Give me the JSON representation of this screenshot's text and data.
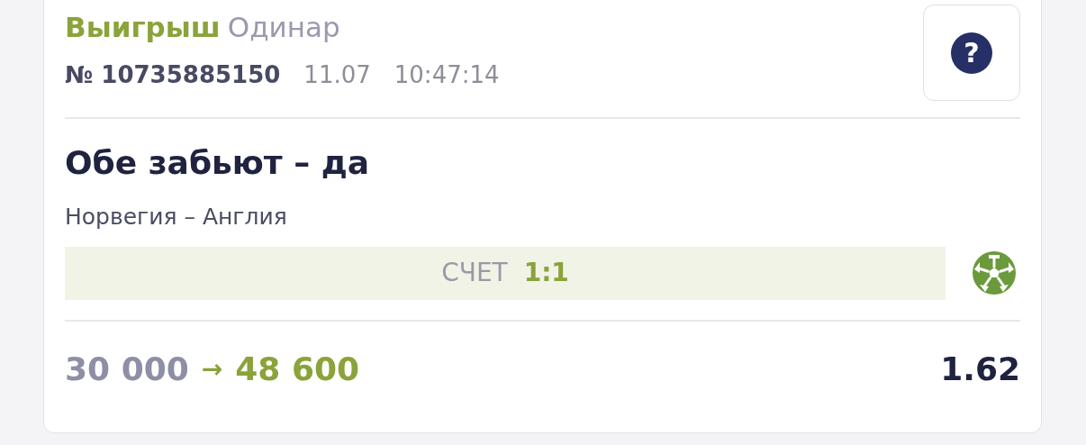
{
  "bet": {
    "result": "Выигрыш",
    "type": "Одинар",
    "number": "№ 10735885150",
    "date": "11.07",
    "time": "10:47:14"
  },
  "help_button": {
    "label": "?"
  },
  "selection": {
    "title": "Обе забьют – да",
    "match": "Норвегия – Англия"
  },
  "score": {
    "label": "СЧЕТ",
    "value": "1:1"
  },
  "totals": {
    "stake": "30 000",
    "arrow": "→",
    "payout": "48 600",
    "odds": "1.62"
  }
}
